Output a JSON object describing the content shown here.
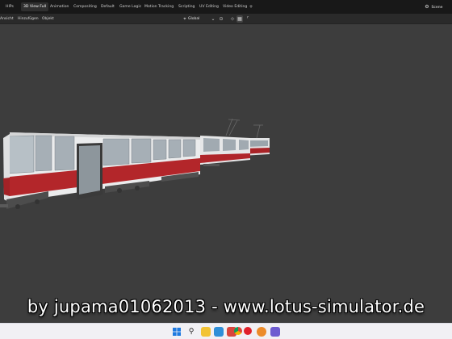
{
  "workspace_tabs": [
    "HIPs",
    "3D View Full",
    "Animation",
    "Compositing",
    "Default",
    "Game Logic",
    "Motion Tracking",
    "Scripting",
    "UV Editing",
    "Video Editing"
  ],
  "active_tab": "3D View Full",
  "add_tab_label": "+",
  "scene_label": "Scene",
  "viewport_menu": [
    "Ansicht",
    "Hinzufügen",
    "Objekt"
  ],
  "orientation_label": "Global",
  "watermark_text": "by jupama01062013 - www.lotus-simulator.de",
  "taskbar_icons": [
    "windows-start-icon",
    "search-icon",
    "file-explorer-icon",
    "store-icon",
    "app-icon",
    "chrome-icon",
    "record-icon",
    "blender-icon",
    "app-icon-2"
  ],
  "colors": {
    "tram_body": "#e9eaeb",
    "tram_stripe": "#b3262a",
    "viewport_bg": "#3d3d3d",
    "topbar_bg": "#181818",
    "taskbar_bg": "#f1f0f4"
  }
}
